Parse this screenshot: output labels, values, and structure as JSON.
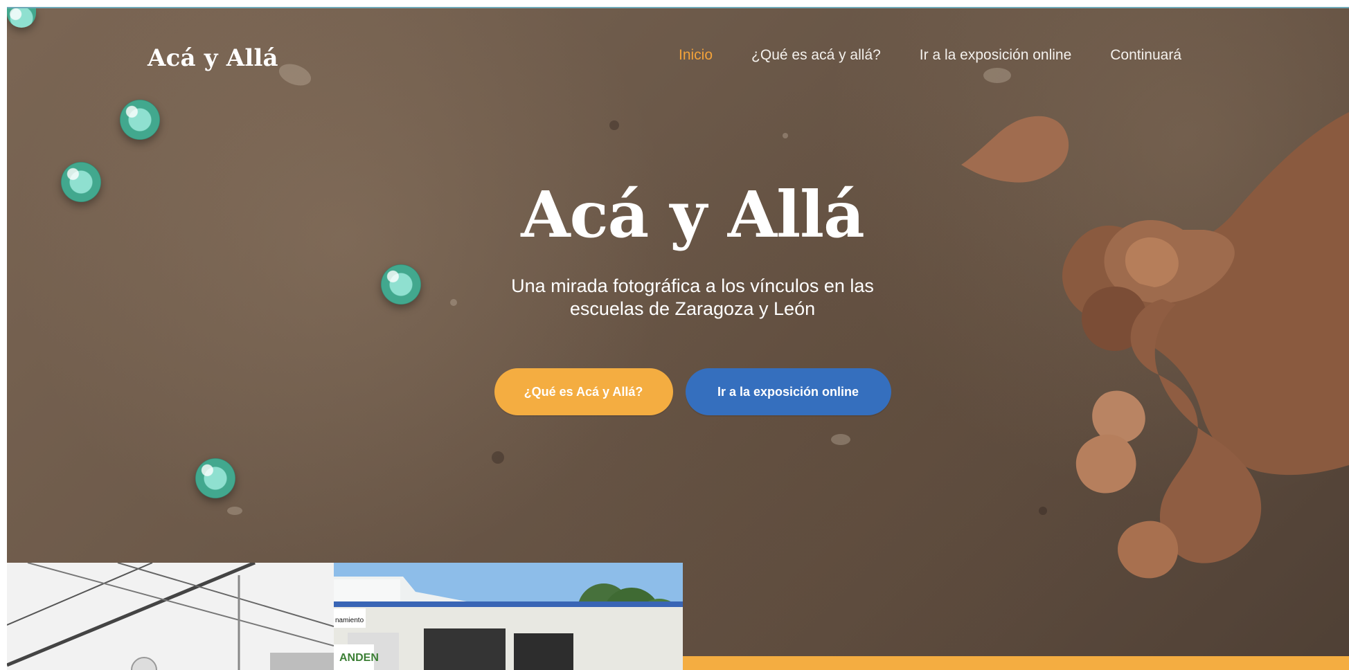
{
  "header": {
    "logo": "Acá y Allá",
    "nav": [
      "Inicio",
      "¿Qué es acá y allá?",
      "Ir a la exposición online",
      "Continuará"
    ]
  },
  "hero": {
    "title": "Acá y Allá",
    "subtitle": "Una mirada fotográfica a los vínculos en las escuelas de Zaragoza y León",
    "buttons": {
      "primary": "¿Qué es Acá y Allá?",
      "secondary": "Ir a la exposición online"
    }
  },
  "gallery": {
    "right_signs": [
      "namiento",
      "ANDEN"
    ]
  },
  "colors": {
    "active_nav": "#f2a23a",
    "primary_button": "#f4ad41",
    "secondary_button": "#356fbe",
    "text": "#ffffff"
  }
}
